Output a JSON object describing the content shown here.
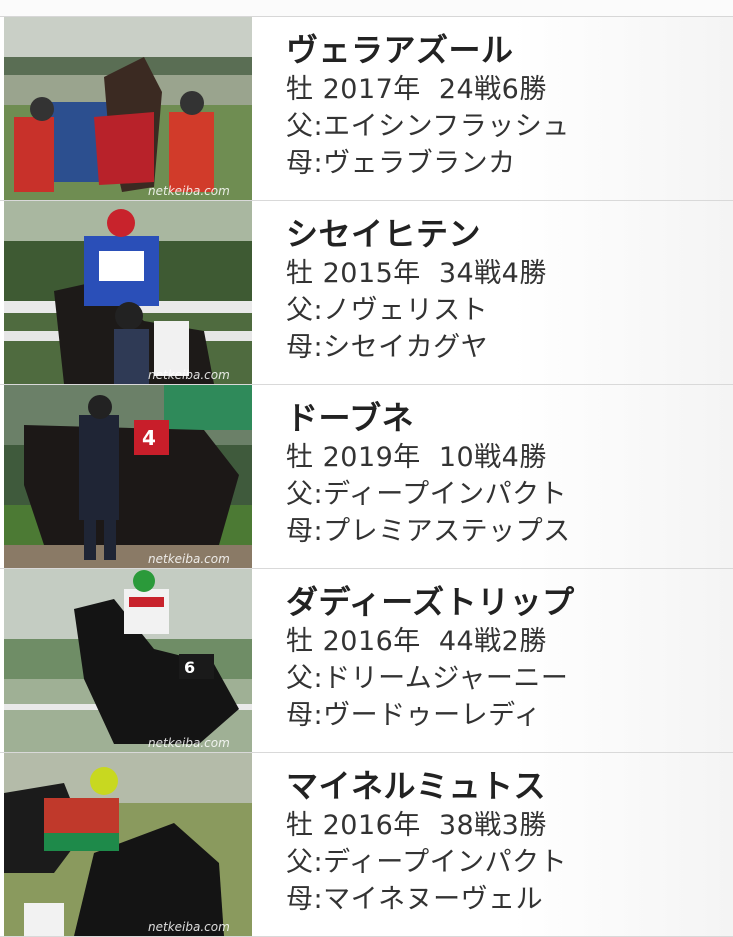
{
  "horses": [
    {
      "name": "ヴェラアズール",
      "sex": "牡",
      "year": "2017年",
      "record": "24戦6勝",
      "sire": "父:エイシンフラッシュ",
      "dam": "母:ヴェラブランカ",
      "photo_credit": "netkeiba.com"
    },
    {
      "name": "シセイヒテン",
      "sex": "牡",
      "year": "2015年",
      "record": "34戦4勝",
      "sire": "父:ノヴェリスト",
      "dam": "母:シセイカグヤ",
      "photo_credit": "netkeiba.com"
    },
    {
      "name": "ドーブネ",
      "sex": "牡",
      "year": "2019年",
      "record": "10戦4勝",
      "sire": "父:ディープインパクト",
      "dam": "母:プレミアステップス",
      "photo_credit": "netkeiba.com"
    },
    {
      "name": "ダディーズトリップ",
      "sex": "牡",
      "year": "2016年",
      "record": "44戦2勝",
      "sire": "父:ドリームジャーニー",
      "dam": "母:ヴードゥーレディ",
      "photo_credit": "netkeiba.com"
    },
    {
      "name": "マイネルミュトス",
      "sex": "牡",
      "year": "2016年",
      "record": "38戦3勝",
      "sire": "父:ディープインパクト",
      "dam": "母:マイネヌーヴェル",
      "photo_credit": "netkeiba.com"
    }
  ],
  "colors": {
    "text": "#222222",
    "divider": "#d9d9d9"
  }
}
